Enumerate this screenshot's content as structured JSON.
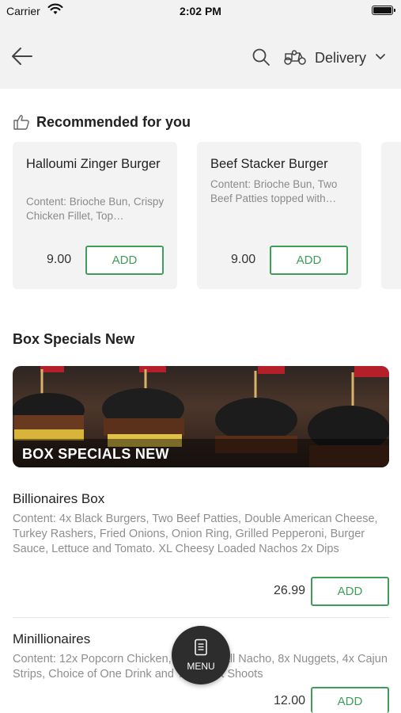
{
  "status": {
    "carrier": "Carrier",
    "time": "2:02 PM"
  },
  "nav": {
    "delivery_label": "Delivery",
    "icons": [
      "back-arrow-icon",
      "search-icon",
      "scooter-icon",
      "chevron-down-icon"
    ]
  },
  "recommended": {
    "title": "Recommended for you",
    "items": [
      {
        "name": "Halloumi Zinger Burger",
        "description": "Content: Brioche Bun, Crispy Chicken Fillet, Top…",
        "price": "9.00",
        "add_label": "ADD"
      },
      {
        "name": "Beef Stacker Burger",
        "description": "Content: Brioche Bun, Two Beef Patties topped with…",
        "price": "9.00",
        "add_label": "ADD"
      }
    ]
  },
  "section": {
    "title": "Box Specials New",
    "banner_text": "BOX SPECIALS NEW",
    "items": [
      {
        "name": "Billionaires Box",
        "description": "Content: 4x Black Burgers, Two Beef Patties, Double American Cheese, Turkey Rashers, Fried Onions, Onion Ring, Grilled Pepperoni, Burger Sauce, Lettuce and Tomato.  XL Cheesy Loaded Nachos 2x Dips",
        "price": "26.99",
        "add_label": "ADD"
      },
      {
        "name": "Minillionaires",
        "description": "Content: 12x Popcorn Chicken, Fries, Small Nacho, 8x Nuggets, 4x Cajun Strips, Choice of One Drink and Two Fruit Shoots",
        "price": "12.00",
        "add_label": "ADD"
      }
    ]
  },
  "menu_button": {
    "label": "MENU"
  },
  "colors": {
    "accent": "#3f9d5a",
    "header_bg": "#f2f2f2",
    "card_bg": "#f3f3f3",
    "fab_bg": "#2d2d2d"
  }
}
